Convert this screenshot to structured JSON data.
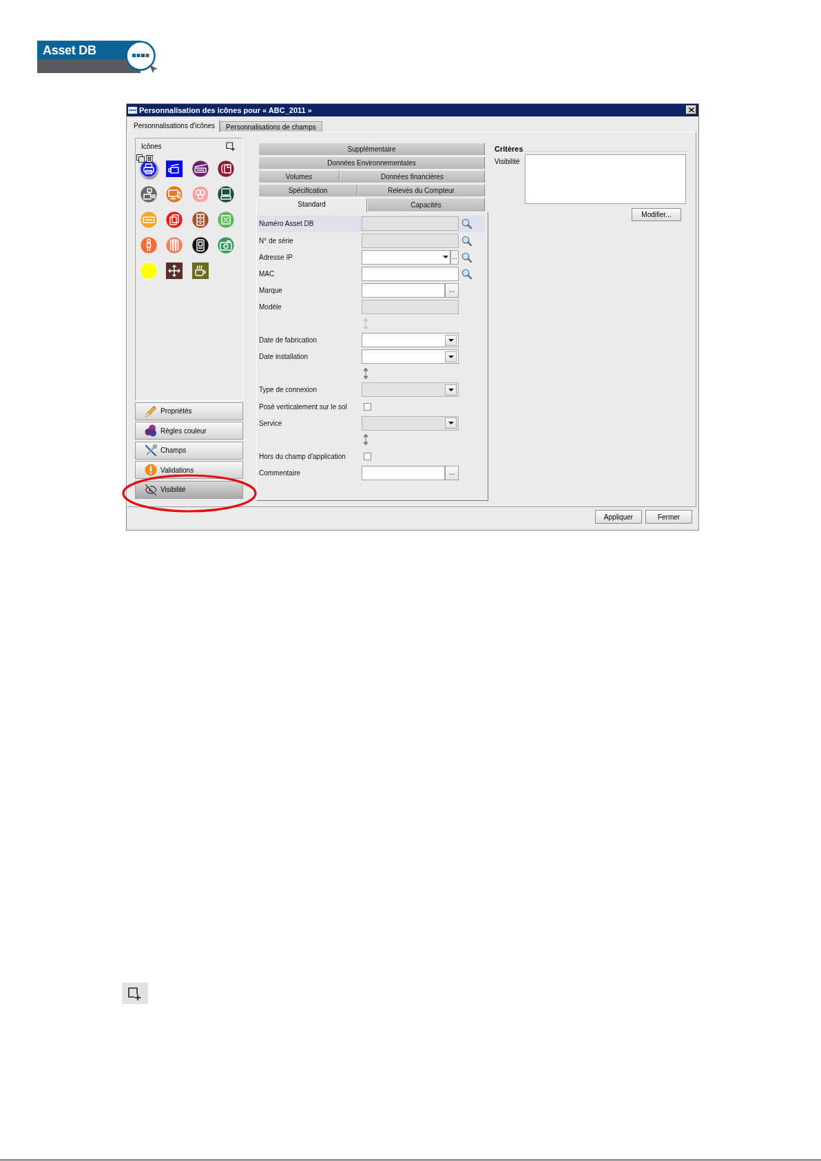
{
  "logo": {
    "text": "Asset DB"
  },
  "dialog": {
    "title": "Personnalisation des icônes pour « ABC_2011 »"
  },
  "tabs": [
    {
      "label": "Personnalisations d'icônes",
      "selected": true
    },
    {
      "label": "Personnalisations de champs",
      "selected": false
    }
  ],
  "icon_panel": {
    "title": "Icônes",
    "icons": [
      {
        "kind": "circle",
        "color": "#1a1aee",
        "selected": true
      },
      {
        "kind": "square",
        "color": "#0808f8",
        "selected": false
      },
      {
        "kind": "circle",
        "color": "#6b1f6b",
        "selected": false
      },
      {
        "kind": "circle",
        "color": "#8a1a2e",
        "selected": false
      },
      {
        "kind": "circle",
        "color": "#686868",
        "selected": false
      },
      {
        "kind": "circle",
        "color": "#e07a1f",
        "selected": false
      },
      {
        "kind": "circle",
        "color": "#f4a6a6",
        "selected": false
      },
      {
        "kind": "circle",
        "color": "#1b4d3e",
        "selected": false
      },
      {
        "kind": "circle",
        "color": "#f5a623",
        "selected": false
      },
      {
        "kind": "circle",
        "color": "#e31b1b",
        "selected": false
      },
      {
        "kind": "circle",
        "color": "#a0522d",
        "selected": false
      },
      {
        "kind": "circle",
        "color": "#5cb85c",
        "selected": false
      },
      {
        "kind": "circle",
        "color": "#f26b3a",
        "selected": false
      },
      {
        "kind": "circle",
        "color": "#f47c5a",
        "selected": false
      },
      {
        "kind": "circle",
        "color": "#111111",
        "selected": false
      },
      {
        "kind": "circle",
        "color": "#3a9a5c",
        "selected": false
      },
      {
        "kind": "circle",
        "color": "#ffff00",
        "selected": false
      },
      {
        "kind": "square",
        "color": "#5a2d2d",
        "selected": false
      },
      {
        "kind": "square",
        "color": "#6b6b1a",
        "selected": false
      }
    ]
  },
  "sections": [
    {
      "label": "Propriétés",
      "selected": false,
      "highlighted": false
    },
    {
      "label": "Règles couleur",
      "selected": false,
      "highlighted": false
    },
    {
      "label": "Champs",
      "selected": false,
      "highlighted": false
    },
    {
      "label": "Validations",
      "selected": false,
      "highlighted": false
    },
    {
      "label": "Visibilité",
      "selected": true,
      "highlighted": true
    }
  ],
  "tab_rows": [
    {
      "tabs": [
        {
          "label": "Supplémentaire",
          "selected": false
        }
      ]
    },
    {
      "tabs": [
        {
          "label": "Données Environnementales",
          "selected": false
        }
      ]
    },
    {
      "tabs": [
        {
          "label": "Volumes",
          "selected": false
        },
        {
          "label": "Données financières",
          "selected": false
        }
      ]
    },
    {
      "tabs": [
        {
          "label": "Spécification",
          "selected": false
        },
        {
          "label": "Relevés du Compteur",
          "selected": false
        }
      ]
    },
    {
      "tabs": [
        {
          "label": "Standard",
          "selected": true
        },
        {
          "label": "Capacités",
          "selected": false
        }
      ]
    }
  ],
  "form": {
    "rows": [
      {
        "kind": "text",
        "label": "Numéro Asset DB",
        "disabled": true,
        "search": true,
        "selected": true
      },
      {
        "kind": "text",
        "label": "N° de série",
        "disabled": true,
        "search": true,
        "selected": false
      },
      {
        "kind": "combo_browse",
        "label": "Adresse IP",
        "disabled": false,
        "button": "...",
        "search": true,
        "selected": false
      },
      {
        "kind": "text",
        "label": "MAC",
        "disabled": false,
        "search": true,
        "selected": false
      },
      {
        "kind": "browse",
        "label": "Marque",
        "disabled": false,
        "button": "...",
        "search": false,
        "selected": false
      },
      {
        "kind": "text",
        "label": "Modèle",
        "disabled": true,
        "search": false,
        "selected": false
      },
      {
        "kind": "mover",
        "disabled": true,
        "selected": false
      },
      {
        "kind": "dropdown",
        "label": "Date de fabrication",
        "disabled": false,
        "search": false,
        "selected": false
      },
      {
        "kind": "dropdown",
        "label": "Date installation",
        "disabled": false,
        "search": false,
        "selected": false
      },
      {
        "kind": "mover",
        "disabled": false,
        "selected": false
      },
      {
        "kind": "dropdown",
        "label": "Type de connexion",
        "disabled": true,
        "search": false,
        "selected": false
      },
      {
        "kind": "checkbox",
        "label": "Posé verticalement sur le sol",
        "checked": false,
        "search": false,
        "selected": false
      },
      {
        "kind": "dropdown",
        "label": "Service",
        "disabled": true,
        "search": false,
        "selected": false
      },
      {
        "kind": "mover",
        "disabled": false,
        "selected": false
      },
      {
        "kind": "checkbox",
        "label": "Hors du champ d'application",
        "checked": false,
        "search": false,
        "selected": false
      },
      {
        "kind": "browse",
        "label": "Commentaire",
        "disabled": false,
        "button": "...",
        "search": false,
        "selected": false
      }
    ]
  },
  "criteria": {
    "title": "Critères",
    "label": "Visibilité",
    "button": "Modifier..."
  },
  "buttons": [
    "Appliquer",
    "Fermer"
  ]
}
